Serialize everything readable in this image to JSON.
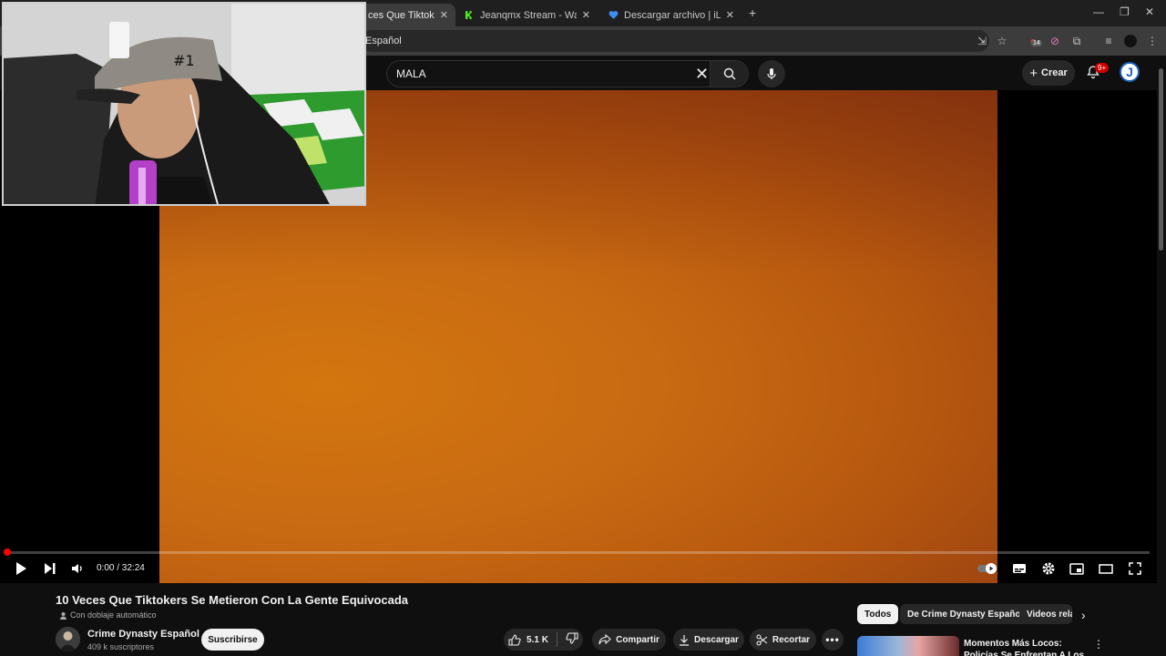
{
  "browser": {
    "tabs": [
      {
        "title": "ces Que Tiktokers Se",
        "active": true
      },
      {
        "title": "Jeanqmx Stream - Watch Live o",
        "active": false
      },
      {
        "title": "Descargar archivo | iLoveIMG",
        "active": false
      }
    ],
    "new_tab": "+",
    "address": "Español",
    "extension_badge": "14"
  },
  "header": {
    "search_value": "MALA",
    "create_label": "Crear",
    "notification_badge": "9+",
    "avatar_letter": "J"
  },
  "player": {
    "time": "0:00 / 32:24",
    "progress": 0.0,
    "frame_colors": {
      "light": "#d3760f",
      "dark": "#8e3a12"
    }
  },
  "video": {
    "title": "10 Veces Que Tiktokers Se Metieron Con La Gente Equivocada",
    "dub_label": "Con doblaje automático",
    "channel_name": "Crime Dynasty Español",
    "subscribers": "409 k suscriptores",
    "subscribe_label": "Suscribirse",
    "likes": "5.1 K",
    "share_label": "Compartir",
    "download_label": "Descargar",
    "clip_label": "Recortar"
  },
  "recommendations": {
    "chips": [
      "Todos",
      "De Crime Dynasty Español",
      "Videos rela"
    ],
    "first_title": "Momentos Más Locos: Policías Se Enfrentan A Los Criminales"
  },
  "colors": {
    "accent_red": "#ff0000",
    "background": "#0f0f0f",
    "link_blue": "#1c62b9"
  }
}
